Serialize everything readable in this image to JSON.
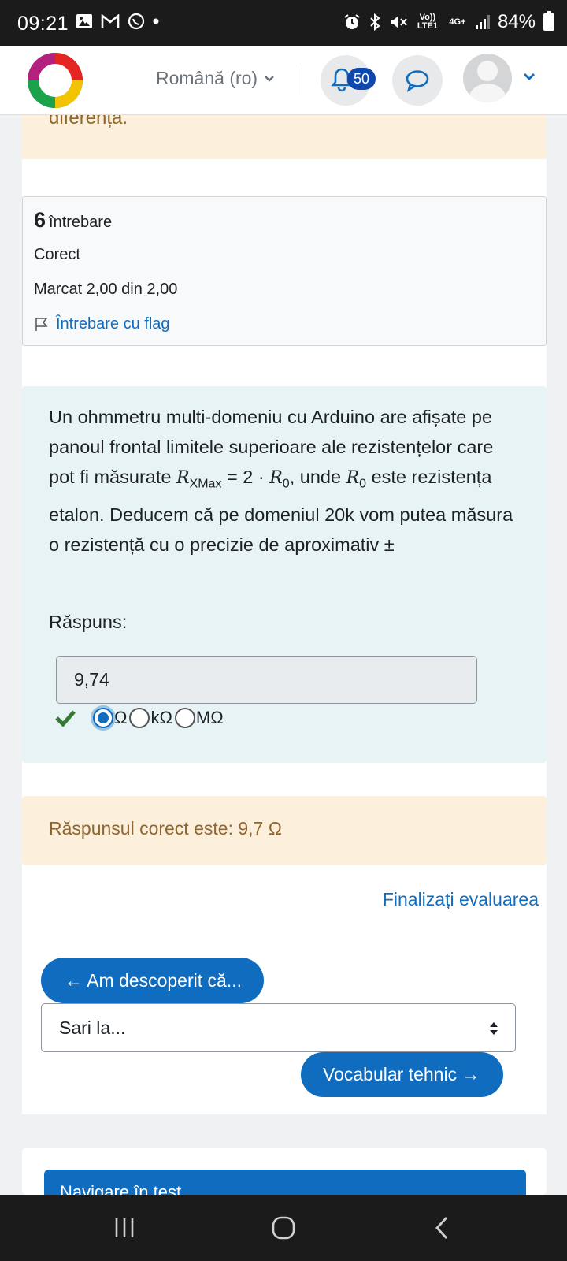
{
  "status_bar": {
    "time": "09:21",
    "volte": "Vo)) LTE1",
    "network": "4G+",
    "battery": "84%"
  },
  "header": {
    "language": "Română (ro)",
    "notification_count": "50"
  },
  "previous_feedback": {
    "text": "diferența."
  },
  "question_info": {
    "number": "6",
    "label": "întrebare",
    "state": "Corect",
    "grade": "Marcat 2,00 din 2,00",
    "flag": "Întrebare cu flag"
  },
  "question": {
    "text_1": "Un ohmmetru multi-domeniu cu Arduino are afișate pe panoul frontal limitele superioare ale rezistențelor care pot fi măsurate ",
    "r_var": "R",
    "r_sub": "XMax",
    "text_2": " = 2 · ",
    "r0_var": "R",
    "r0_sub": "0",
    "text_3": ", unde ",
    "r0b_var": "R",
    "r0b_sub": "0",
    "text_4": " este rezistența etalon. Deducem că pe domeniul 20k vom putea măsura o rezistență cu o precizie de aproximativ ±",
    "answer_label": "Răspuns:",
    "answer_value": "9,74",
    "units": [
      "Ω",
      "kΩ",
      "MΩ"
    ],
    "selected_unit": "Ω"
  },
  "right_answer": {
    "text": "Răspunsul corect este: 9,7 Ω"
  },
  "navigation": {
    "finish_link": "Finalizați evaluarea",
    "prev_button": "← Am descoperit că...",
    "jump_placeholder": "Sari la...",
    "next_button": "Vocabular tehnic →",
    "quiz_nav_title": "Navigare în test"
  },
  "colors": {
    "primary": "#0f6cbf",
    "badge": "#0f47ad",
    "feedback_bg": "#fcefdc",
    "feedback_text": "#8e662e",
    "formulation_bg": "#e7f3f5",
    "correct_check": "#357a32"
  }
}
